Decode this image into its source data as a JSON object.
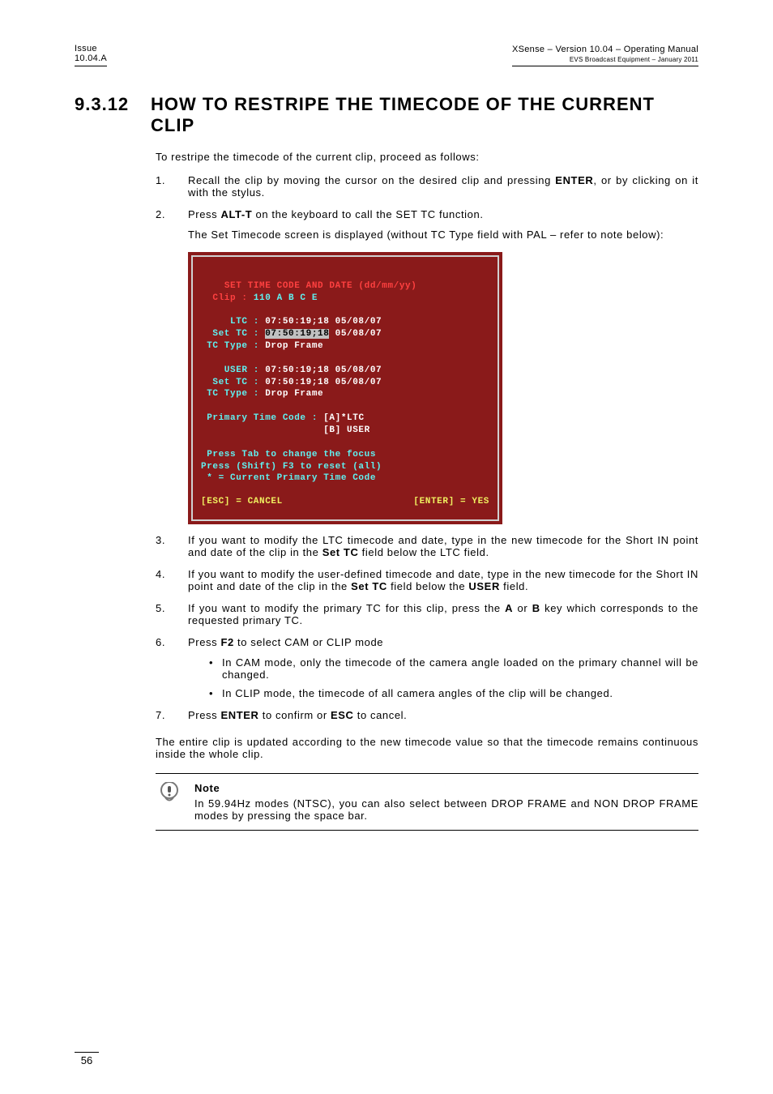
{
  "header": {
    "issue_label": "Issue",
    "issue_value": "10.04.A",
    "title": "XSense – Version 10.04 – Operating Manual",
    "subtitle": "EVS Broadcast Equipment  – January 2011"
  },
  "section": {
    "number": "9.3.12",
    "title": "HOW TO RESTRIPE THE TIMECODE OF THE CURRENT CLIP"
  },
  "intro": "To restripe the timecode of the current clip, proceed as follows:",
  "steps": {
    "s1": {
      "n": "1.",
      "pre": "Recall the clip by moving the cursor on the desired clip and pressing ",
      "bold": "ENTER",
      "post": ", or by clicking on it with the stylus."
    },
    "s2": {
      "n": "2.",
      "pre": "Press ",
      "bold": "ALT-T",
      "post": " on the keyboard to call the SET TC function.",
      "followup": "The Set Timecode screen is displayed (without TC Type field with PAL – refer to note below):"
    },
    "s3": {
      "n": "3.",
      "pre": "If you want to modify the LTC timecode and date, type in the new timecode for the Short IN point and date of the clip in the ",
      "bold": "Set TC",
      "post": " field below the LTC field."
    },
    "s4": {
      "n": "4.",
      "pre": "If you want to modify the user-defined timecode and date, type in the new timecode for the Short IN point and date of the clip in the ",
      "bold": "Set TC",
      "post_a": " field below the ",
      "bold_b": "USER",
      "post_b": " field."
    },
    "s5": {
      "n": "5.",
      "pre": "If you want to modify the primary TC for this clip, press the ",
      "bold_a": "A",
      "mid": " or ",
      "bold_b": "B",
      "post": " key which corresponds to the requested primary TC."
    },
    "s6": {
      "n": "6.",
      "pre": "Press ",
      "bold": "F2",
      "post": " to select CAM or CLIP mode",
      "bullets": [
        "In CAM mode, only the timecode of the camera angle loaded on the primary channel will be changed.",
        "In CLIP mode, the timecode of all camera angles of the clip will be changed."
      ]
    },
    "s7": {
      "n": "7.",
      "pre": "Press ",
      "bold_a": "ENTER",
      "mid": " to confirm or ",
      "bold_b": "ESC",
      "post": " to cancel."
    }
  },
  "closing": "The entire clip is updated according to the new timecode value so that the timecode remains continuous inside the whole clip.",
  "note": {
    "label": "Note",
    "text": "In 59.94Hz modes (NTSC), you can also select between DROP FRAME and NON DROP FRAME modes by pressing the space bar."
  },
  "screen": {
    "title": "SET TIME CODE AND DATE (dd/mm/yy)",
    "clip_label": "Clip : ",
    "clip_value": "110 A B C E",
    "row_ltc_label": "     LTC : ",
    "row_ltc_value": "07:50:19;18 05/08/07",
    "row_set1_label": "  Set TC : ",
    "row_set1_value": "07:50:19;18",
    "row_set1_date": " 05/08/07",
    "row_tct1_label": " TC Type : ",
    "row_tct1_value": "Drop Frame",
    "row_user_label": "    USER : ",
    "row_user_value": "07:50:19;18 05/08/07",
    "row_set2_label": "  Set TC : ",
    "row_set2_value": "07:50:19;18 05/08/07",
    "row_tct2_label": " TC Type : ",
    "row_tct2_value": "Drop Frame",
    "primary_label": " Primary Time Code : ",
    "primary_a": "[A]*LTC",
    "primary_b": "                     [B] USER",
    "help1": " Press Tab to change the focus",
    "help2": "Press (Shift) F3 to reset (all)",
    "help3": " * = Current Primary Time Code",
    "esc": "[ESC] = CANCEL",
    "enter": "[ENTER] = YES"
  },
  "page_number": "56"
}
